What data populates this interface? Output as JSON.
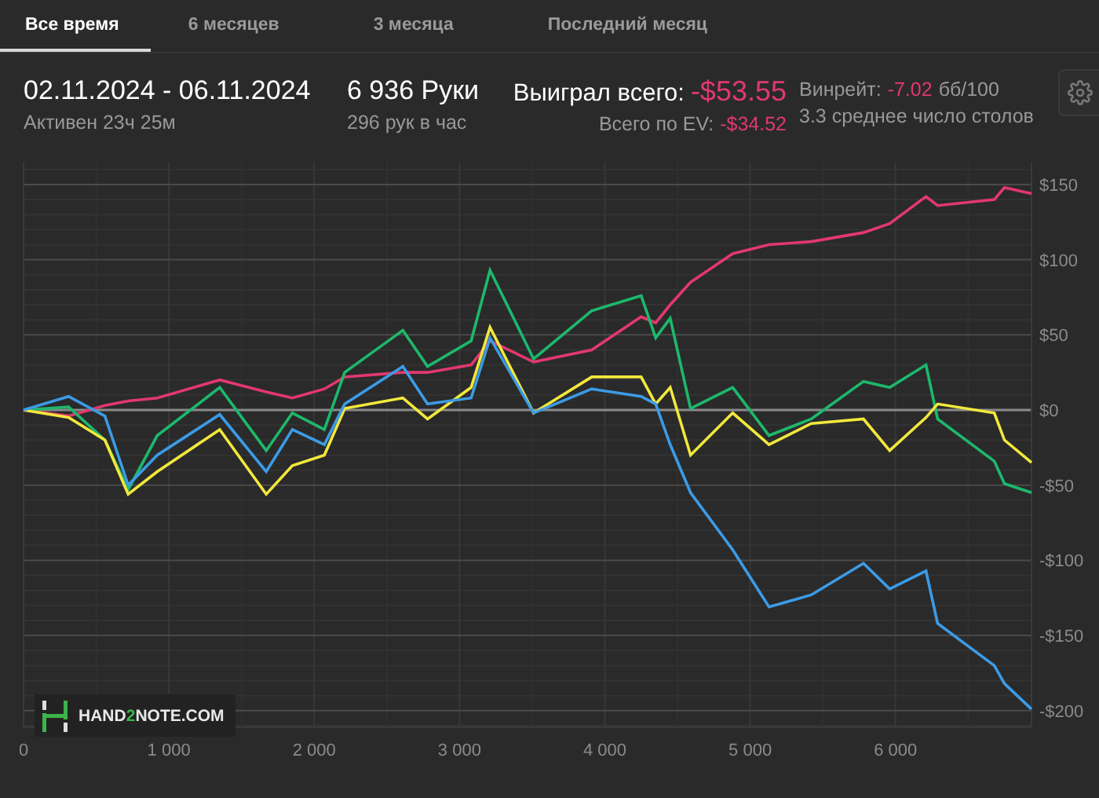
{
  "tabs": [
    {
      "label": "Все время",
      "selected": true
    },
    {
      "label": "6 месяцев",
      "selected": false
    },
    {
      "label": "3 месяца",
      "selected": false
    },
    {
      "label": "Последний месяц",
      "selected": false
    }
  ],
  "summary": {
    "period": "02.11.2024 - 06.11.2024",
    "active": "Активен 23ч 25м",
    "hands": "6 936 Руки",
    "hands_per_hour": "296 рук в час",
    "won_label": "Выиграл всего:",
    "won_value": "-$53.55",
    "ev_label": "Всего по EV:",
    "ev_value": "-$34.52",
    "winrate_label": "Винрейт:",
    "winrate_value": "-7.02",
    "winrate_unit": "бб/100",
    "tables": "3.3 среднее число столов"
  },
  "chart": {
    "logo": [
      {
        "text": "HAND",
        "kind": "plain"
      },
      {
        "text": "2",
        "kind": "accent"
      },
      {
        "text": "NOTE.COM",
        "kind": "plain"
      }
    ],
    "chart_data": {
      "type": "line",
      "x": [
        0,
        310,
        560,
        720,
        920,
        1350,
        1670,
        1850,
        2070,
        2210,
        2610,
        2780,
        3080,
        3210,
        3510,
        3910,
        4250,
        4350,
        4450,
        4590,
        4880,
        5130,
        5420,
        5780,
        5960,
        6210,
        6290,
        6680,
        6750,
        6936
      ],
      "series": [
        {
          "color": "#e2386e",
          "values": [
            0,
            -4,
            3,
            6,
            8,
            20,
            12,
            8,
            14,
            22,
            25,
            25,
            30,
            46,
            32,
            40,
            62,
            58,
            70,
            85,
            104,
            110,
            112,
            118,
            124,
            142,
            136,
            140,
            148,
            144
          ]
        },
        {
          "color": "#1db86c",
          "values": [
            0,
            2,
            -20,
            -53,
            -17,
            15,
            -27,
            -2,
            -13,
            25,
            53,
            29,
            46,
            93,
            34,
            66,
            76,
            48,
            61,
            1,
            15,
            -17,
            -6,
            19,
            15,
            30,
            -6,
            -34,
            -49,
            -55
          ]
        },
        {
          "color": "#f2e83c",
          "values": [
            0,
            -5,
            -20,
            -56,
            -41,
            -13,
            -56,
            -37,
            -30,
            1,
            8,
            -6,
            15,
            55,
            -2,
            22,
            22,
            4,
            15,
            -30,
            -2,
            -23,
            -9,
            -6,
            -27,
            -5,
            4,
            -2,
            -20,
            -35
          ]
        },
        {
          "color": "#3c9be6",
          "values": [
            0,
            9,
            -4,
            -50,
            -30,
            -3,
            -41,
            -13,
            -23,
            4,
            29,
            4,
            8,
            48,
            -2,
            14,
            9,
            4,
            -23,
            -55,
            -93,
            -131,
            -123,
            -102,
            -119,
            -107,
            -142,
            -170,
            -182,
            -199
          ]
        }
      ],
      "grid": true,
      "xlim": [
        0,
        6936
      ],
      "ylim": [
        -211,
        165
      ],
      "xticks": [
        {
          "value": 0,
          "label": "0"
        },
        {
          "value": 1000,
          "label": "1 000"
        },
        {
          "value": 2000,
          "label": "2 000"
        },
        {
          "value": 3000,
          "label": "3 000"
        },
        {
          "value": 4000,
          "label": "4 000"
        },
        {
          "value": 5000,
          "label": "5 000"
        },
        {
          "value": 6000,
          "label": "6 000"
        }
      ],
      "yticks": [
        {
          "value": 150,
          "label": "$150"
        },
        {
          "value": 100,
          "label": "$100"
        },
        {
          "value": 50,
          "label": "$50"
        },
        {
          "value": 0,
          "label": "$0"
        },
        {
          "value": -50,
          "label": "-$50"
        },
        {
          "value": -100,
          "label": "-$100"
        },
        {
          "value": -150,
          "label": "-$150"
        },
        {
          "value": -200,
          "label": "-$200"
        }
      ]
    }
  }
}
